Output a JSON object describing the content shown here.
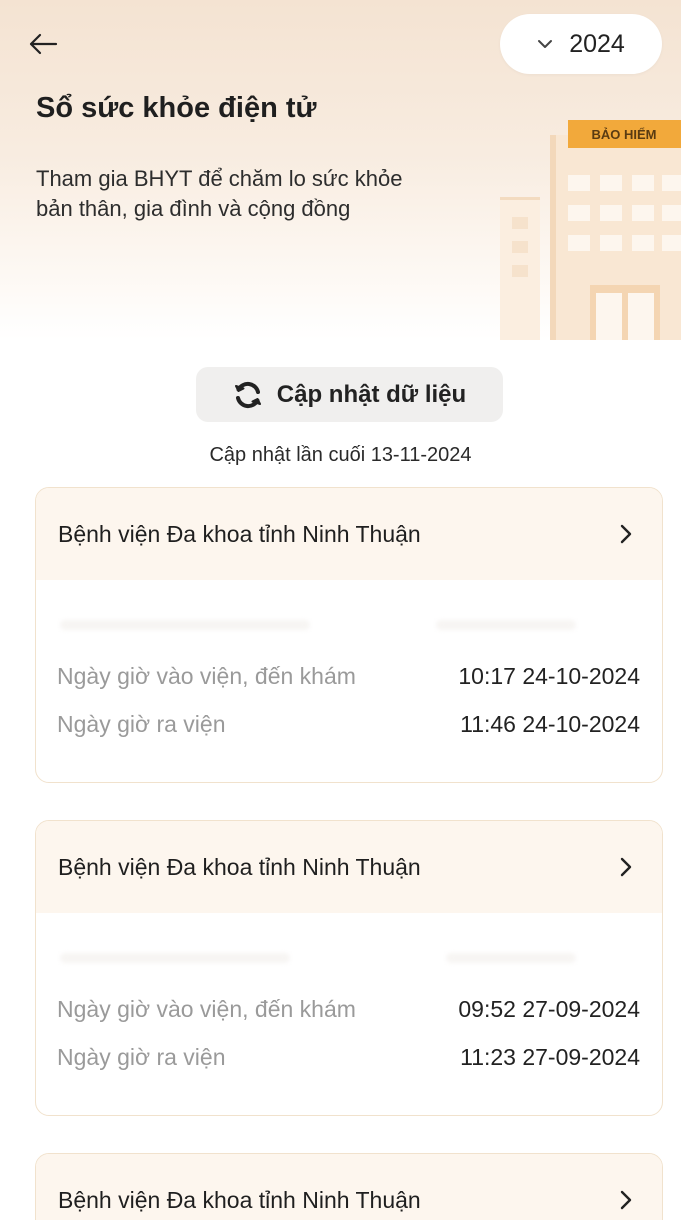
{
  "header": {
    "title": "Sổ sức khỏe điện tử",
    "subtitle": "Tham gia BHYT để chăm lo sức khỏe bản thân, gia đình và cộng đồng",
    "year_selected": "2024",
    "building_sign": "BẢO HIỂM"
  },
  "sync": {
    "button_label": "Cập nhật dữ liệu",
    "last_update": "Cập nhật lần cuối 13-11-2024"
  },
  "visits": [
    {
      "hospital": "Bệnh viện Đa khoa tỉnh Ninh Thuận",
      "admit_label": "Ngày giờ vào viện, đến khám",
      "admit_value": "10:17 24-10-2024",
      "discharge_label": "Ngày giờ ra viện",
      "discharge_value": "11:46 24-10-2024"
    },
    {
      "hospital": "Bệnh viện Đa khoa tỉnh Ninh Thuận",
      "admit_label": "Ngày giờ vào viện, đến khám",
      "admit_value": "09:52 27-09-2024",
      "discharge_label": "Ngày giờ ra viện",
      "discharge_value": "11:23 27-09-2024"
    },
    {
      "hospital": "Bệnh viện Đa khoa tỉnh Ninh Thuận"
    }
  ],
  "colors": {
    "accent": "#f2a93b",
    "card_border": "#f1e2cd",
    "card_header_bg": "#fdf6ee"
  },
  "icons": {
    "back": "arrow-left-icon",
    "year_dropdown": "chevron-down-icon",
    "refresh": "refresh-icon",
    "card_open": "chevron-right-icon"
  }
}
